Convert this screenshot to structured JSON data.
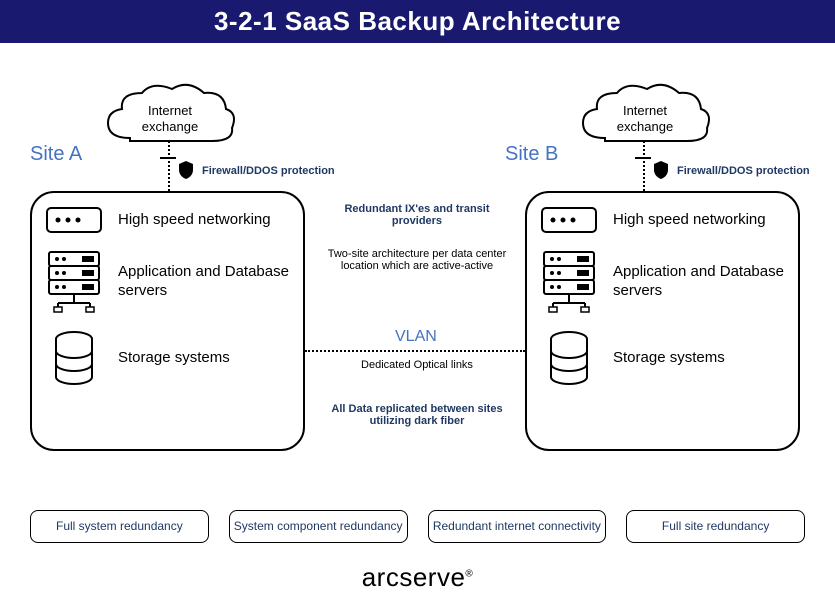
{
  "title": "3-2-1 SaaS Backup Architecture",
  "siteA": {
    "label": "Site A"
  },
  "siteB": {
    "label": "Site B"
  },
  "cloud": {
    "line1": "Internet",
    "line2": "exchange"
  },
  "firewall_label": "Firewall/DDOS protection",
  "rows": {
    "networking": "High speed networking",
    "servers": "Application and Database servers",
    "storage": "Storage systems"
  },
  "mid": {
    "m1": "Redundant IX'es and transit providers",
    "m2": "Two-site architecture per data center location which are active-active",
    "vlan": "VLAN",
    "m3": "Dedicated Optical links",
    "m4": "All Data replicated between sites utilizing dark fiber"
  },
  "bottom": {
    "b1": "Full system redundancy",
    "b2": "System component redundancy",
    "b3": "Redundant internet connectivity",
    "b4": "Full site redundancy"
  },
  "brand": "arcserve"
}
